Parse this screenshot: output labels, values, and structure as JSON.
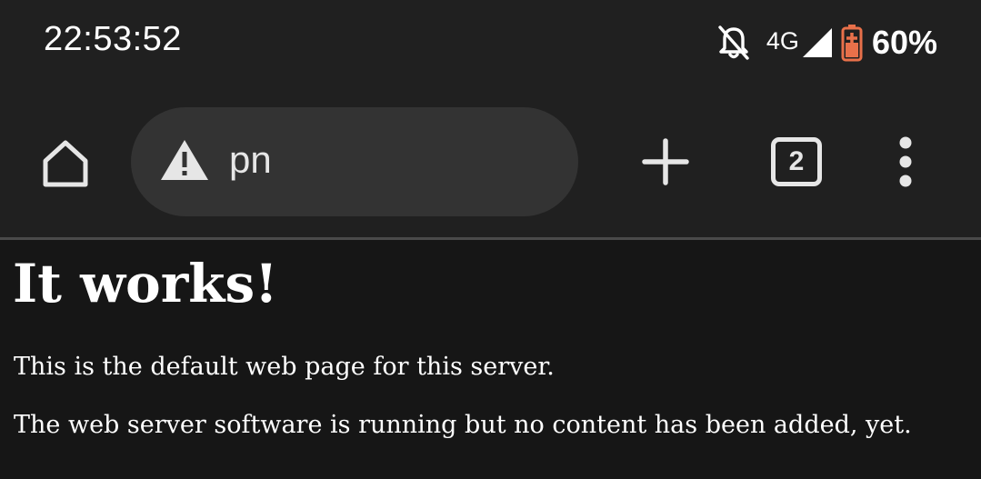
{
  "status_bar": {
    "time": "22:53:52",
    "network": "4G",
    "battery": "60%",
    "icons": [
      "notifications-off-icon",
      "signal-icon",
      "battery-icon"
    ]
  },
  "toolbar": {
    "url": "pn",
    "tab_count": "2",
    "icons": [
      "home-icon",
      "warning-icon",
      "plus-icon",
      "tabs-icon",
      "more-vert-icon"
    ]
  },
  "page": {
    "heading": "It works!",
    "paragraphs": [
      "This is the default web page for this server.",
      "The web server software is running but no content has been added, yet."
    ]
  },
  "colors": {
    "background": "#161616",
    "chrome": "#202020",
    "omnibox": "#333333",
    "battery_accent": "#e8704a"
  }
}
